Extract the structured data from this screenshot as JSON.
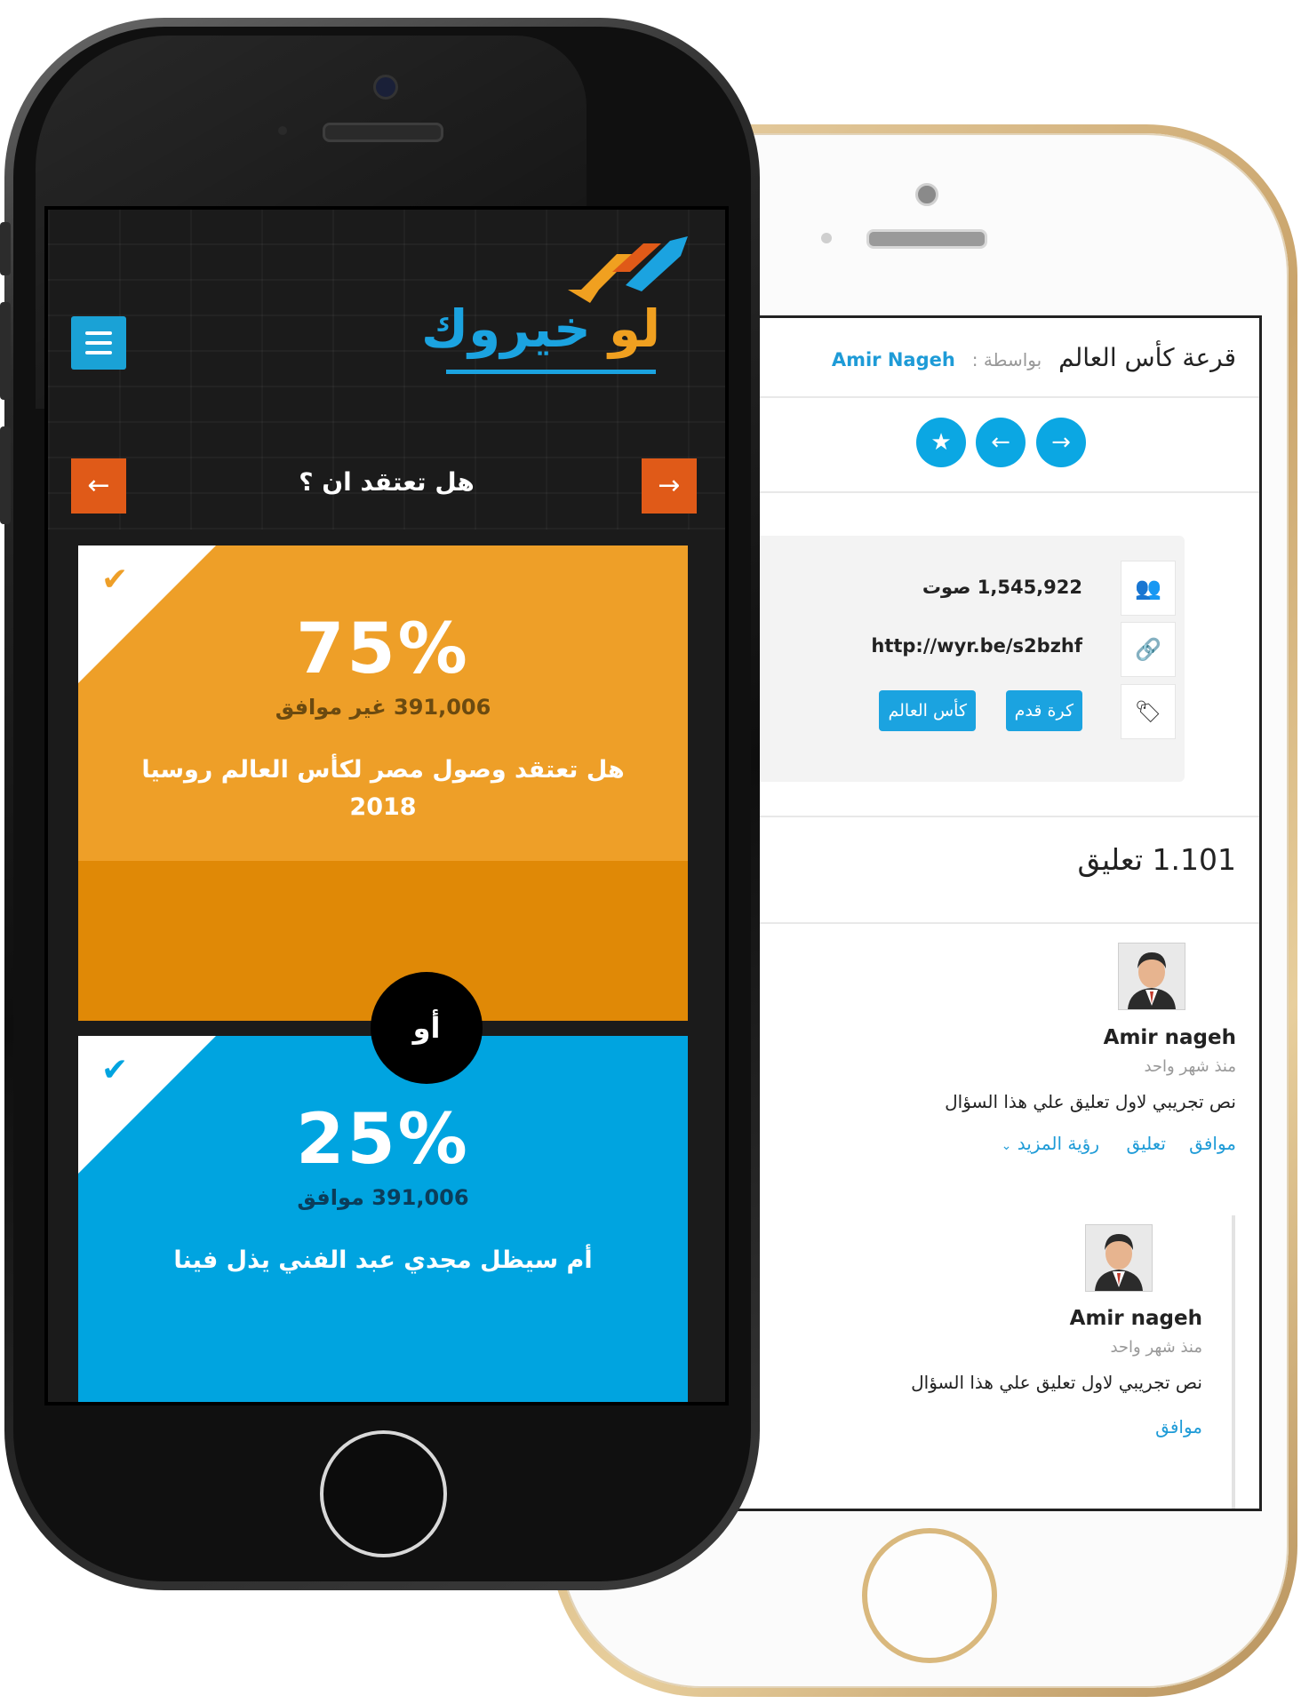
{
  "back_phone": {
    "title": "قرعة كأس العالم",
    "by_label": "بواسطة :",
    "author": "Amir Nageh",
    "nav_icons": [
      "star-icon",
      "arrow-left-icon",
      "arrow-right-icon"
    ],
    "info": {
      "votes": "1,545,922 صوت",
      "link": "http://wyr.be/s2bzhf",
      "tags": [
        "كرة قدم",
        "كأس العالم"
      ]
    },
    "comments_heading": "1.101 تعليق",
    "comments": [
      {
        "name": "Amir nageh",
        "time": "منذ شهر واحد",
        "text": "نص تجريبي لاول تعليق علي هذا السؤال",
        "actions": [
          "موافق",
          "تعليق",
          "رؤية المزيد"
        ]
      },
      {
        "name": "Amir nageh",
        "time": "منذ شهر واحد",
        "text": "نص تجريبي لاول تعليق علي هذا السؤال",
        "actions": [
          "موافق"
        ]
      }
    ]
  },
  "front_phone": {
    "logo_text": "خيروك",
    "logo_prefix": "لو",
    "question": "هل تعتقد ان ؟",
    "or_label": "أو",
    "option_a": {
      "percent": "75%",
      "votes": "391,006 غير موافق",
      "text": "هل تعتقد وصول مصر لكأس العالم روسيا 2018",
      "color": "#ee9f28"
    },
    "option_b": {
      "percent": "25%",
      "votes": "391,006 موافق",
      "text": "أم سيظل مجدي عبد الفني يذل فينا",
      "color": "#00a4e0"
    }
  }
}
